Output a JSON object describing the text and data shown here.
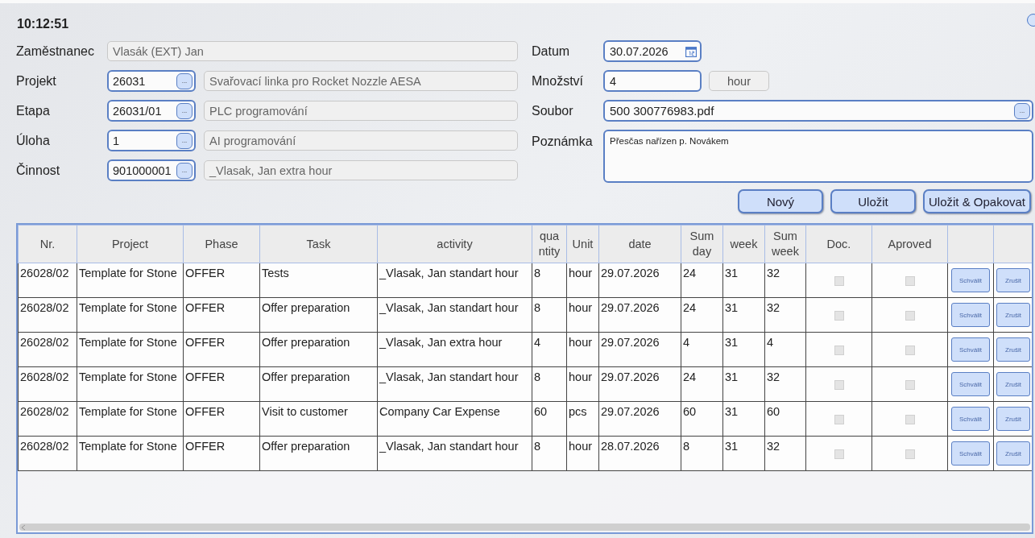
{
  "clock": "10:12:51",
  "left_fields": [
    {
      "kind": "text",
      "label": "Zaměstnanec",
      "value": "Vlasák (EXT) Jan"
    },
    {
      "kind": "lookup",
      "label": "Projekt",
      "code": "26031",
      "button": "...",
      "description": "Svařovací linka pro Rocket Nozzle AESA"
    },
    {
      "kind": "lookup",
      "label": "Etapa",
      "code": "26031/01",
      "button": "...",
      "description": "PLC programování"
    },
    {
      "kind": "lookup",
      "label": "Úloha",
      "code": "1",
      "button": "...",
      "description": "AI programování"
    },
    {
      "kind": "lookup",
      "label": "Činnost",
      "code": "901000001",
      "button": "...",
      "description": "_Vlasak, Jan extra hour"
    }
  ],
  "right_fields": [
    {
      "kind": "date",
      "label": "Datum",
      "value": "30.07.2026"
    },
    {
      "kind": "quantity",
      "label": "Množství",
      "value": "4",
      "unit": "hour"
    },
    {
      "kind": "file",
      "label": "Soubor",
      "value": "500 300776983.pdf",
      "button": "..."
    },
    {
      "kind": "note",
      "label": "Poznámka",
      "value": "Přesčas nařízen p. Novákem"
    }
  ],
  "actions": [
    "Nový",
    "Uložit",
    "Uložit & Opakovat"
  ],
  "table": {
    "columns": [
      "Nr.",
      "Project",
      "Phase",
      "Task",
      "activity",
      "qua ntity",
      "Unit",
      "date",
      "Sum day",
      "week",
      "Sum week",
      "Doc.",
      "Aproved"
    ],
    "rows": [
      {
        "cells": [
          "26028/02",
          "Template for Stone",
          "OFFER",
          "Tests",
          "_Vlasak, Jan standart hour",
          "8",
          "hour",
          "29.07.2026",
          "24",
          "31",
          "32"
        ],
        "doc_checked": false,
        "approved_checked": false,
        "approve_button": "Schválit",
        "cancel_button": "Zrušit"
      },
      {
        "cells": [
          "26028/02",
          "Template for Stone",
          "OFFER",
          "Offer preparation",
          "_Vlasak, Jan standart hour",
          "8",
          "hour",
          "29.07.2026",
          "24",
          "31",
          "32"
        ],
        "doc_checked": false,
        "approved_checked": false,
        "approve_button": "Schválit",
        "cancel_button": "Zrušit"
      },
      {
        "cells": [
          "26028/02",
          "Template for Stone",
          "OFFER",
          "Offer preparation",
          "_Vlasak, Jan extra hour",
          "4",
          "hour",
          "29.07.2026",
          "4",
          "31",
          "4"
        ],
        "doc_checked": false,
        "approved_checked": false,
        "approve_button": "Schválit",
        "cancel_button": "Zrušit"
      },
      {
        "cells": [
          "26028/02",
          "Template for Stone",
          "OFFER",
          "Offer preparation",
          "_Vlasak, Jan standart hour",
          "8",
          "hour",
          "29.07.2026",
          "24",
          "31",
          "32"
        ],
        "doc_checked": false,
        "approved_checked": false,
        "approve_button": "Schválit",
        "cancel_button": "Zrušit"
      },
      {
        "cells": [
          "26028/02",
          "Template for Stone",
          "OFFER",
          "Visit to customer",
          "Company Car Expense",
          "60",
          "pcs",
          "29.07.2026",
          "60",
          "31",
          "60"
        ],
        "doc_checked": false,
        "approved_checked": false,
        "approve_button": "Schválit",
        "cancel_button": "Zrušit"
      },
      {
        "cells": [
          "26028/02",
          "Template for Stone",
          "OFFER",
          "Offer preparation",
          "_Vlasak, Jan standart hour",
          "8",
          "hour",
          "28.07.2026",
          "8",
          "31",
          "32"
        ],
        "doc_checked": false,
        "approved_checked": false,
        "approve_button": "Schválit",
        "cancel_button": "Zrušit"
      }
    ]
  }
}
